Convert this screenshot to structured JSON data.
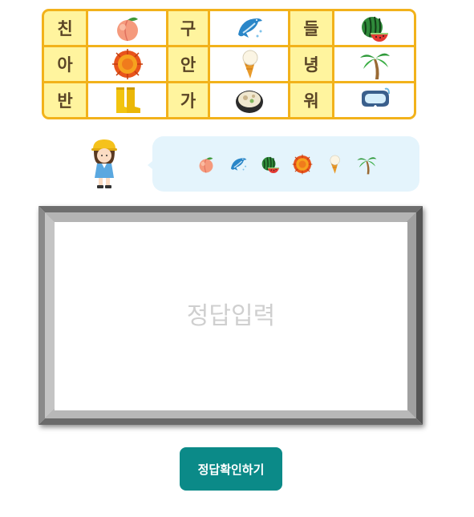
{
  "cipher_table": {
    "rows": [
      [
        {
          "char": "친",
          "icon": "peach-icon"
        },
        {
          "char": "구",
          "icon": "dolphin-icon"
        },
        {
          "char": "들",
          "icon": "watermelon-icon"
        }
      ],
      [
        {
          "char": "아",
          "icon": "sea-urchin-icon"
        },
        {
          "char": "안",
          "icon": "ice-cream-icon"
        },
        {
          "char": "녕",
          "icon": "palm-tree-icon"
        }
      ],
      [
        {
          "char": "반",
          "icon": "rain-boots-icon"
        },
        {
          "char": "가",
          "icon": "soup-bowl-icon"
        },
        {
          "char": "워",
          "icon": "diving-mask-icon"
        }
      ]
    ]
  },
  "hint": {
    "character_icon": "hardhat-girl-icon",
    "sequence": [
      "peach-icon",
      "dolphin-icon",
      "watermelon-icon",
      "sea-urchin-icon",
      "ice-cream-icon",
      "palm-tree-icon"
    ]
  },
  "answer": {
    "placeholder": "정답입력",
    "value": ""
  },
  "check_button": {
    "label": "정답확인하기"
  },
  "colors": {
    "table_border": "#f2b21b",
    "char_cell": "#fff49e",
    "bubble": "#e4f4fc",
    "button": "#0b8a88"
  }
}
